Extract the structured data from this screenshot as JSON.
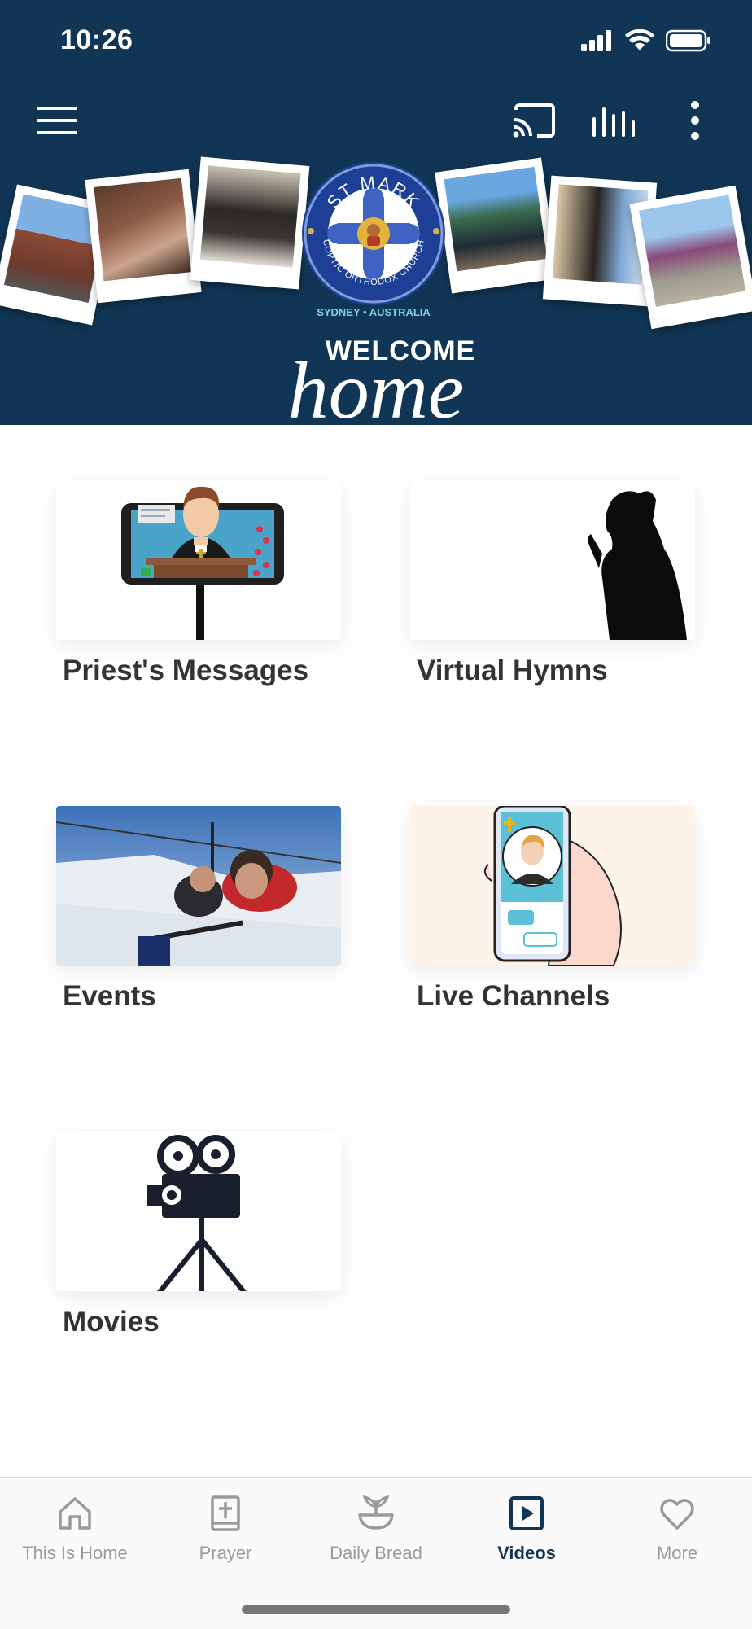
{
  "status_bar": {
    "time": "10:26"
  },
  "header": {
    "logo": {
      "arc_text": "ST MARK",
      "ring_text": "COPTIC ORTHODOX CHURCH",
      "location": "SYDNEY • AUSTRALIA"
    },
    "welcome_small": "WELCOME",
    "welcome_big": "home",
    "toolbar_icons": [
      "menu-icon",
      "cast-icon",
      "equalizer-icon",
      "more-vert-icon"
    ],
    "colors": {
      "background": "#113655"
    }
  },
  "cards": [
    {
      "label": "Priest's Messages"
    },
    {
      "label": "Virtual Hymns"
    },
    {
      "label": "Events"
    },
    {
      "label": "Live Channels"
    },
    {
      "label": "Movies"
    }
  ],
  "bottom_nav": {
    "items": [
      {
        "label": "This Is Home",
        "icon": "home-icon",
        "active": false
      },
      {
        "label": "Prayer",
        "icon": "bible-icon",
        "active": false
      },
      {
        "label": "Daily Bread",
        "icon": "wheat-bowl-icon",
        "active": false
      },
      {
        "label": "Videos",
        "icon": "play-square-icon",
        "active": true
      },
      {
        "label": "More",
        "icon": "heart-icon",
        "active": false
      }
    ],
    "colors": {
      "active": "#113655",
      "inactive": "#9a9a9a"
    }
  }
}
